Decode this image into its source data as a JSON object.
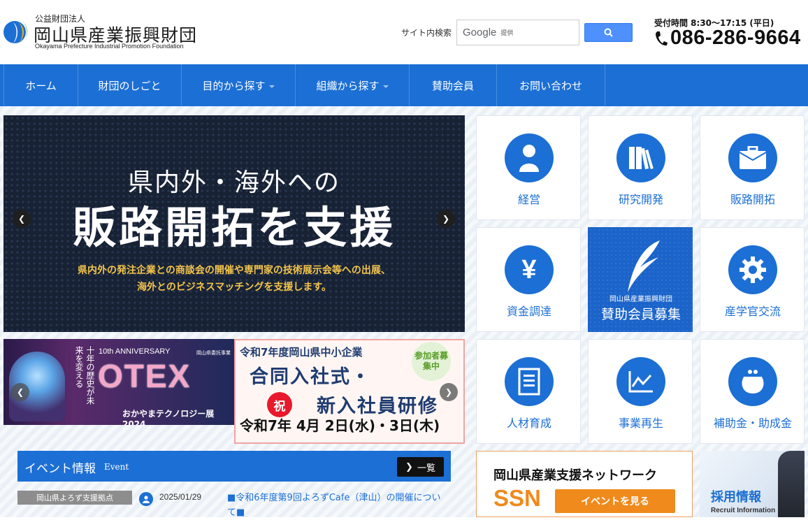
{
  "header": {
    "org_type": "公益財団法人",
    "org_name": "岡山県産業振興財団",
    "org_name_en": "Okayama Prefecture Industrial Promotion Foundation",
    "search_label": "サイト内検索",
    "search_brand": "Google",
    "search_brand_sub": "提供",
    "hours": "受付時間 8:30～17:15 (平日)",
    "phone": "086-286-9664"
  },
  "nav": {
    "items": [
      {
        "label": "ホーム"
      },
      {
        "label": "財団のしごと"
      },
      {
        "label": "目的から探す"
      },
      {
        "label": "組織から探す"
      },
      {
        "label": "賛助会員"
      },
      {
        "label": "お問い合わせ"
      }
    ]
  },
  "hero": {
    "line1": "県内外・海外への",
    "line2": "販路開拓を支援",
    "desc1": "県内外の発注企業との商談会の開催や専門家の技術展示会等への出展、",
    "desc2": "海外とのビジネスマッチングを支援します。"
  },
  "banners": {
    "otex_anniv": "10th ANNIVERSARY",
    "otex_small": "岡山県委託事業",
    "otex_logo": "OTEX",
    "otex_vertical": "十年の歴史が未来を変える",
    "otex_expo": "おかやまテクノロジー展2024",
    "job_line1": "令和7年度岡山県中小企業",
    "job_line2": "合同入社式・",
    "job_iwai": "祝",
    "job_line3": "新入社員研修",
    "job_date": "令和7年 4月 2日(水)・3日(木)",
    "job_badge": "参加者募集中"
  },
  "event": {
    "title": "イベント情報",
    "title_en": "Event",
    "more": "一覧",
    "items": [
      {
        "tag": "岡山県よろず支援拠点",
        "date": "2025/01/29",
        "text": "■令和6年度第9回よろずCafe（津山）の開催について■"
      }
    ]
  },
  "tiles": [
    {
      "label": "経営"
    },
    {
      "label": "研究開発"
    },
    {
      "label": "販路開拓"
    },
    {
      "label": "資金調達"
    },
    {
      "label": "岡山県産業振興財団",
      "label2": "賛助会員募集"
    },
    {
      "label": "産学官交流"
    },
    {
      "label": "人材育成"
    },
    {
      "label": "事業再生"
    },
    {
      "label": "補助金・助成金"
    }
  ],
  "ssn": {
    "title": "岡山県産業支援ネットワーク",
    "logo": "SSN",
    "button": "イベントを見る"
  },
  "recruit": {
    "title": "採用情報",
    "title_en": "Recruit Information"
  },
  "colors": {
    "primary": "#1c6fd4",
    "accent_orange": "#f08a1c",
    "hero_bg": "#182235",
    "hero_text_gold": "#f3c44b"
  }
}
